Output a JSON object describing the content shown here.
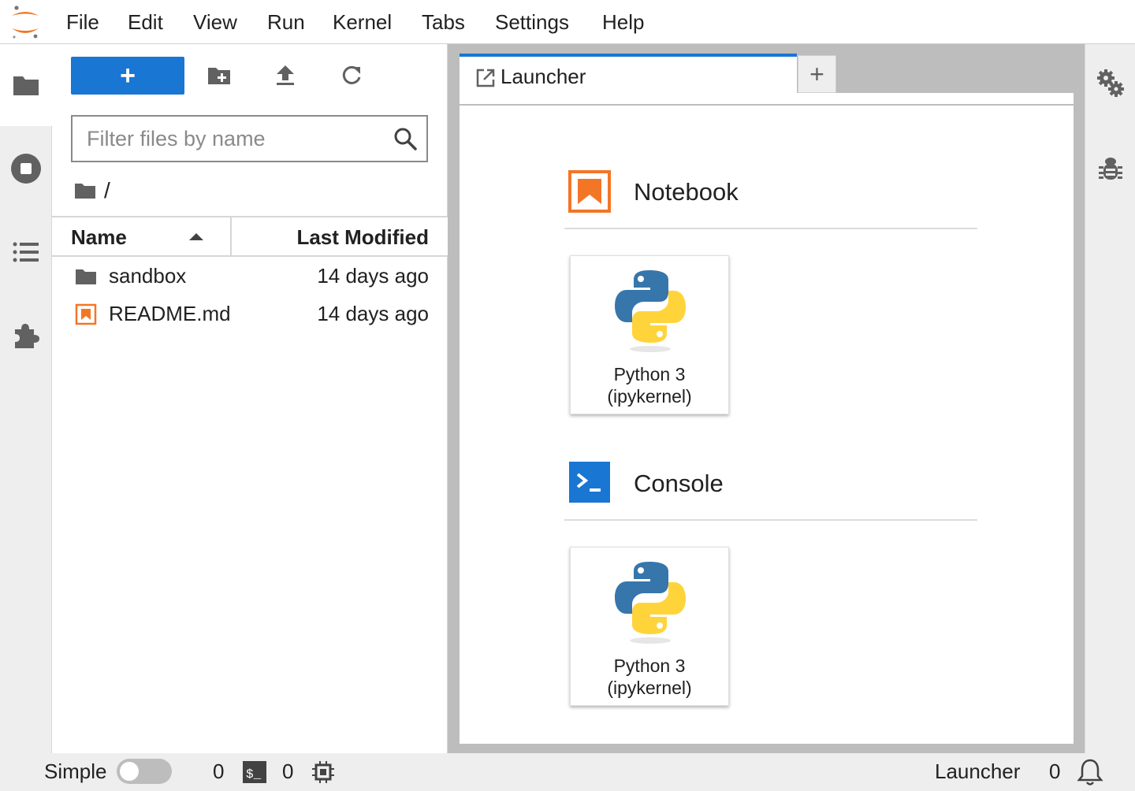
{
  "menubar": {
    "items": [
      "File",
      "Edit",
      "View",
      "Run",
      "Kernel",
      "Tabs",
      "Settings",
      "Help"
    ]
  },
  "filebrowser": {
    "new_label": "+",
    "filter_placeholder": "Filter files by name",
    "breadcrumb": "/",
    "columns": {
      "name": "Name",
      "modified": "Last Modified"
    },
    "sort": "name-ascending",
    "files": [
      {
        "name": "sandbox",
        "type": "folder",
        "modified": "14 days ago"
      },
      {
        "name": "README.md",
        "type": "markdown",
        "modified": "14 days ago"
      }
    ]
  },
  "tabs": {
    "active_label": "Launcher",
    "add_label": "+"
  },
  "launcher": {
    "sections": [
      {
        "title": "Notebook",
        "icon": "notebook-icon",
        "color": "#f37626",
        "cards": [
          {
            "label_line1": "Python 3",
            "label_line2": "(ipykernel)"
          }
        ]
      },
      {
        "title": "Console",
        "icon": "console-icon",
        "color": "#1976d2",
        "cards": [
          {
            "label_line1": "Python 3",
            "label_line2": "(ipykernel)"
          }
        ]
      }
    ]
  },
  "statusbar": {
    "mode_label": "Simple",
    "simple_mode_on": false,
    "kernels_count": "0",
    "terminals_count": "0",
    "active_label": "Launcher",
    "notifications_count": "0"
  },
  "colors": {
    "accent": "#1976d2",
    "jupyter_orange": "#f37626",
    "python_blue": "#3776ab",
    "python_yellow": "#ffd43b"
  }
}
